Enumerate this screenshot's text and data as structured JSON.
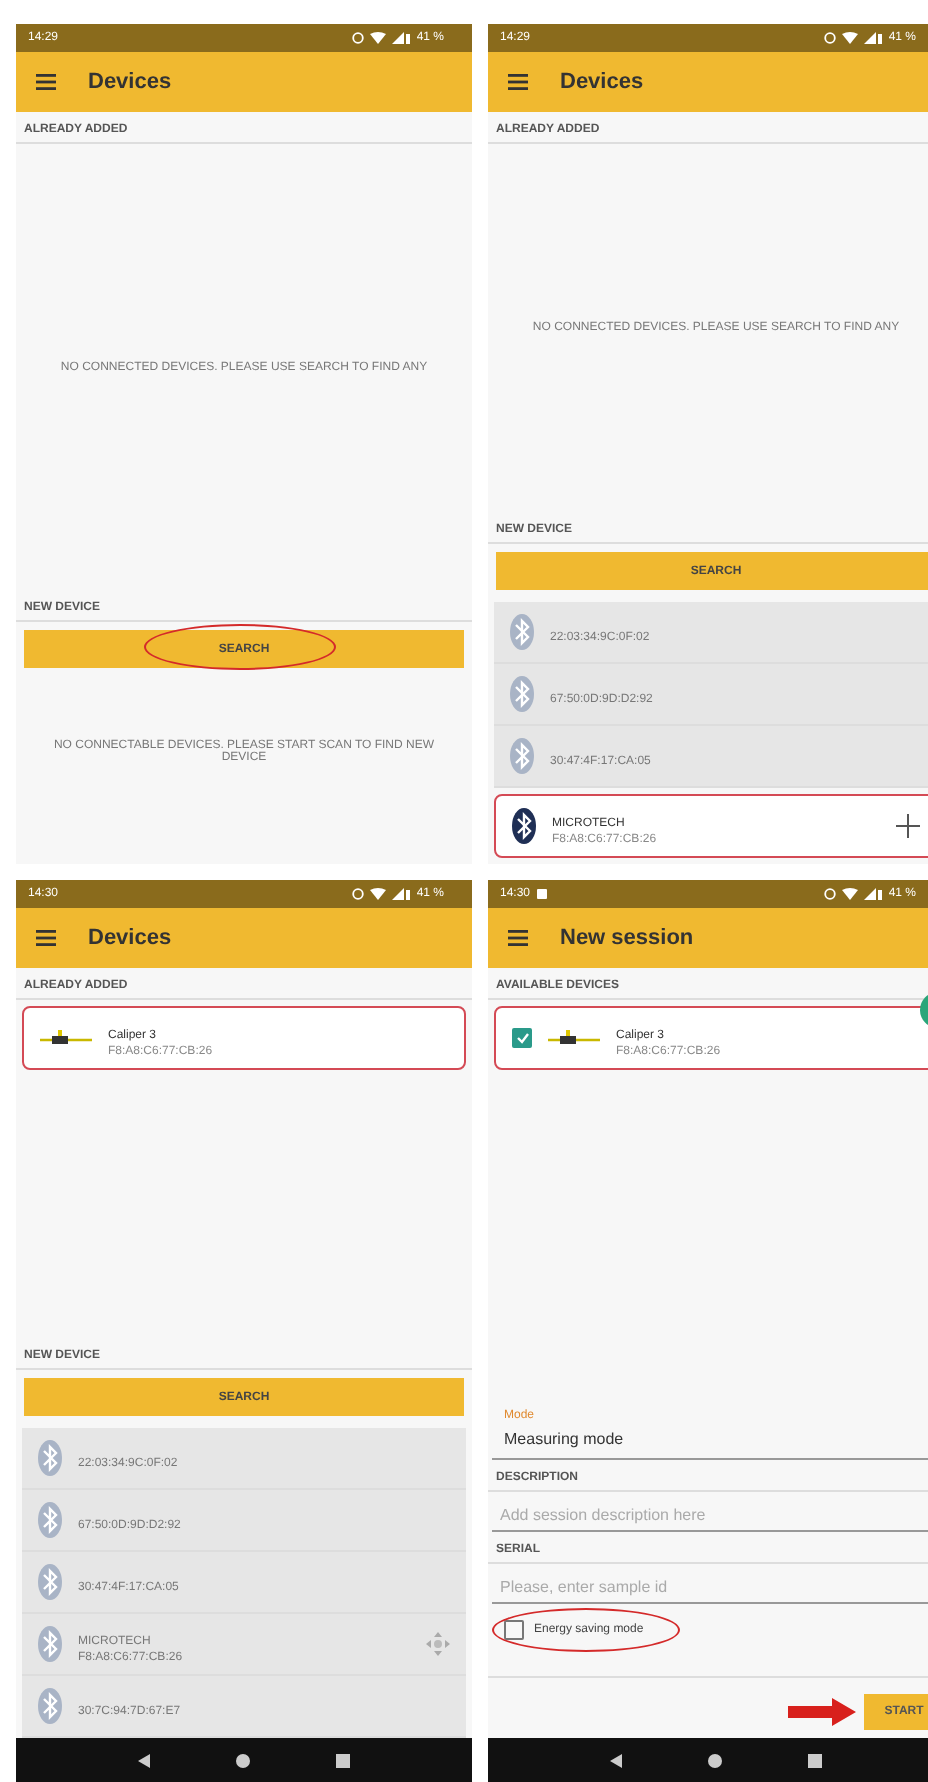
{
  "panels": [
    {
      "status_bar": {
        "time": "14:29",
        "battery": "41 %"
      },
      "title": "Devices",
      "top": [
        {
          "kind": "header",
          "text": "ALREADY ADDED"
        },
        {
          "kind": "message",
          "text": "NO CONNECTED DEVICES. PLEASE USE SEARCH TO FIND ANY"
        }
      ],
      "bottom": [
        {
          "kind": "header",
          "text": "NEW DEVICE"
        },
        {
          "kind": "button",
          "label": "SEARCH",
          "circled": true
        },
        {
          "kind": "message",
          "text": "NO CONNECTABLE DEVICES. PLEASE START SCAN TO FIND NEW DEVICE"
        }
      ]
    },
    {
      "status_bar": {
        "time": "14:29",
        "battery": "41 %"
      },
      "title": "Devices",
      "top": [
        {
          "kind": "header",
          "text": "ALREADY ADDED"
        },
        {
          "kind": "message",
          "text": "NO CONNECTED DEVICES. PLEASE USE SEARCH TO FIND ANY"
        }
      ],
      "bottom": [
        {
          "kind": "header",
          "text": "NEW DEVICE"
        },
        {
          "kind": "button",
          "label": "SEARCH",
          "circled": false
        },
        {
          "kind": "bluetooth_device",
          "address": "22:03:34:9C:0F:02",
          "disabled": true,
          "outlined": false
        },
        {
          "kind": "bluetooth_device",
          "address": "67:50:0D:9D:D2:92",
          "disabled": true,
          "outlined": false
        },
        {
          "kind": "bluetooth_device",
          "address": "30:47:4F:17:CA:05",
          "disabled": true,
          "outlined": false
        },
        {
          "kind": "bluetooth_device",
          "name": "MICROTECH",
          "address": "F8:A8:C6:77:CB:26",
          "disabled": false,
          "outlined": true,
          "add_button": true
        }
      ]
    },
    {
      "status_bar": {
        "time": "14:30",
        "battery": "41 %"
      },
      "title": "Devices",
      "nav_bar": true,
      "top": [
        {
          "kind": "header",
          "text": "ALREADY ADDED"
        },
        {
          "kind": "caliper_device",
          "name": "Caliper 3",
          "address": "F8:A8:C6:77:CB:26",
          "disabled": false,
          "outlined": true
        }
      ],
      "bottom": [
        {
          "kind": "header",
          "text": "NEW DEVICE"
        },
        {
          "kind": "button",
          "label": "SEARCH",
          "circled": false
        },
        {
          "kind": "bluetooth_device",
          "address": "22:03:34:9C:0F:02",
          "disabled": true,
          "outlined": false
        },
        {
          "kind": "bluetooth_device",
          "address": "67:50:0D:9D:D2:92",
          "disabled": true,
          "outlined": false
        },
        {
          "kind": "bluetooth_device",
          "address": "30:47:4F:17:CA:05",
          "disabled": true,
          "outlined": false
        },
        {
          "kind": "bluetooth_device",
          "name": "MICROTECH",
          "address": "F8:A8:C6:77:CB:26",
          "disabled": true,
          "outlined": false,
          "drag_handle": true
        },
        {
          "kind": "bluetooth_device",
          "address": "30:7C:94:7D:67:E7",
          "disabled": true,
          "outlined": false
        }
      ]
    },
    {
      "status_bar": {
        "time": "14:30",
        "battery": "41 %",
        "notification": true
      },
      "title": "New session",
      "fab": true,
      "nav_bar": true,
      "top": [
        {
          "kind": "header",
          "text": "AVAILABLE DEVICES"
        },
        {
          "kind": "caliper_device",
          "name": "Caliper 3",
          "address": "F8:A8:C6:77:CB:26",
          "disabled": false,
          "checked": true,
          "outlined": true
        }
      ],
      "bottom": [
        {
          "kind": "select",
          "label": "Mode",
          "value": "Measuring mode"
        },
        {
          "kind": "header",
          "text": "DESCRIPTION"
        },
        {
          "kind": "input",
          "placeholder": "Add session description here"
        },
        {
          "kind": "header",
          "text": "SERIAL"
        },
        {
          "kind": "input",
          "placeholder": "Please, enter sample id"
        },
        {
          "kind": "checkbox",
          "label": "Energy saving mode",
          "checked": false,
          "circled": true
        },
        {
          "kind": "action",
          "label": "START",
          "arrow": true
        }
      ]
    }
  ]
}
